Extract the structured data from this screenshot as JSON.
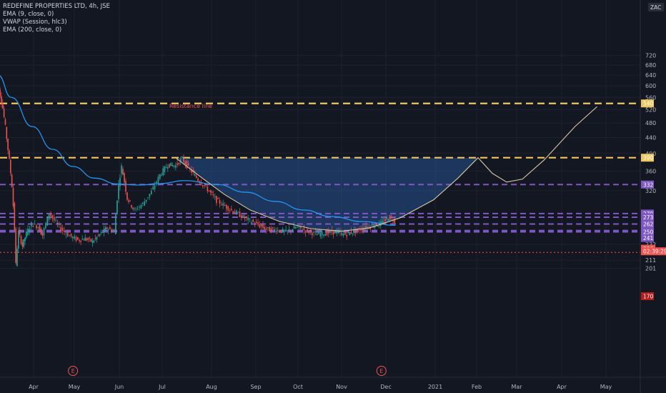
{
  "header": {
    "symbol": "REDEFINE PROPERTIES LTD, 4h, JSE",
    "indicators": [
      "EMA (9, close, 0)",
      "VWAP (Session, hlc3)",
      "EMA (200, close, 0)"
    ],
    "currency": "ZAC"
  },
  "colors": {
    "background": "#131722",
    "grid": "#1e222d",
    "up": "#26a69a",
    "down": "#ef5350",
    "ema200": "#2196f3",
    "resistance": "#f0c75e",
    "support": "#7e57c2",
    "cup_fill": "#2a5ea8",
    "cup_line": "#d9c7a3",
    "current_price": "#ef5350",
    "annotation_text": "#ef5350"
  },
  "chart_data": {
    "type": "candlestick",
    "timeframe": "4h",
    "ylim": [
      166,
      740
    ],
    "y_ticks": [
      720,
      680,
      640,
      600,
      560,
      520,
      480,
      440,
      400,
      360,
      320,
      232,
      211,
      201
    ],
    "x_ticks": [
      "Apr",
      "May",
      "Jun",
      "Jul",
      "Aug",
      "Sep",
      "Oct",
      "Nov",
      "Dec",
      "2021",
      "Feb",
      "Mar",
      "Apr",
      "May"
    ],
    "price_series": {
      "name": "close",
      "points": [
        [
          "Mar 02",
          582
        ],
        [
          "Mar 05",
          596
        ],
        [
          "Mar 07",
          570
        ],
        [
          "Mar 09",
          525
        ],
        [
          "Mar 11",
          468
        ],
        [
          "Mar 13",
          410
        ],
        [
          "Mar 16",
          330
        ],
        [
          "Mar 18",
          255
        ],
        [
          "Mar 19",
          205
        ],
        [
          "Mar 21",
          250
        ],
        [
          "Mar 24",
          230
        ],
        [
          "Mar 27",
          248
        ],
        [
          "Mar 31",
          262
        ],
        [
          "Apr 05",
          258
        ],
        [
          "Apr 08",
          245
        ],
        [
          "Apr 13",
          280
        ],
        [
          "Apr 18",
          264
        ],
        [
          "Apr 23",
          252
        ],
        [
          "Apr 28",
          244
        ],
        [
          "May 04",
          238
        ],
        [
          "May 09",
          240
        ],
        [
          "May 14",
          236
        ],
        [
          "May 19",
          246
        ],
        [
          "May 24",
          256
        ],
        [
          "May 29",
          250
        ],
        [
          "Jun 01",
          332
        ],
        [
          "Jun 03",
          370
        ],
        [
          "Jun 07",
          306
        ],
        [
          "Jun 12",
          284
        ],
        [
          "Jun 18",
          296
        ],
        [
          "Jun 24",
          318
        ],
        [
          "Jun 30",
          352
        ],
        [
          "Jul 05",
          374
        ],
        [
          "Jul 10",
          372
        ],
        [
          "Jul 14",
          388
        ],
        [
          "Jul 18",
          367
        ],
        [
          "Jul 24",
          342
        ],
        [
          "Jul 29",
          326
        ],
        [
          "Aug 05",
          302
        ],
        [
          "Aug 12",
          290
        ],
        [
          "Aug 19",
          280
        ],
        [
          "Aug 26",
          270
        ],
        [
          "Sep 02",
          262
        ],
        [
          "Sep 09",
          254
        ],
        [
          "Sep 16",
          253
        ],
        [
          "Sep 23",
          250
        ],
        [
          "Sep 30",
          257
        ],
        [
          "Oct 07",
          252
        ],
        [
          "Oct 14",
          247
        ],
        [
          "Oct 21",
          248
        ],
        [
          "Oct 28",
          250
        ],
        [
          "Nov 04",
          246
        ],
        [
          "Nov 09",
          250
        ],
        [
          "Nov 16",
          255
        ],
        [
          "Nov 23",
          260
        ],
        [
          "Nov 28",
          262
        ],
        [
          "Dec 03",
          273
        ],
        [
          "Dec 07",
          268
        ]
      ]
    },
    "ema200": {
      "name": "EMA (200, close, 0)",
      "points": [
        [
          "Feb 24",
          708
        ],
        [
          "Mar 05",
          640
        ],
        [
          "Mar 15",
          560
        ],
        [
          "Mar 31",
          470
        ],
        [
          "Apr 15",
          410
        ],
        [
          "Apr 30",
          370
        ],
        [
          "May 15",
          345
        ],
        [
          "May 31",
          333
        ],
        [
          "Jun 15",
          331
        ],
        [
          "Jun 30",
          334
        ],
        [
          "Jul 15",
          340
        ],
        [
          "Aug 05",
          332
        ],
        [
          "Aug 25",
          317
        ],
        [
          "Sep 15",
          300
        ],
        [
          "Oct 05",
          285
        ],
        [
          "Oct 25",
          274
        ],
        [
          "Nov 15",
          266
        ],
        [
          "Dec 07",
          260
        ]
      ]
    },
    "horizontal_levels": [
      {
        "kind": "resistance",
        "value": 540,
        "label": "540"
      },
      {
        "kind": "resistance",
        "value": 390,
        "label": "390"
      },
      {
        "kind": "support",
        "value": 332,
        "label": "332"
      },
      {
        "kind": "support",
        "value": 279,
        "label": "279"
      },
      {
        "kind": "support",
        "value": 273,
        "label": "273"
      },
      {
        "kind": "support",
        "value": 262,
        "label": "262"
      },
      {
        "kind": "support",
        "value": 252,
        "label": "252"
      },
      {
        "kind": "support",
        "value": 250,
        "label": "250"
      }
    ],
    "current_price": {
      "value": 226,
      "time_label": "02:39:29"
    },
    "last_value": {
      "value": 241
    },
    "lows_line": {
      "value": 221
    },
    "last_low": {
      "value": 170
    },
    "cup_and_handle": {
      "points": [
        [
          "Jul 10",
          388
        ],
        [
          "Jul 25",
          348
        ],
        [
          "Aug 10",
          313
        ],
        [
          "Aug 28",
          285
        ],
        [
          "Sep 18",
          266
        ],
        [
          "Oct 10",
          255
        ],
        [
          "Nov 01",
          251
        ],
        [
          "Nov 20",
          256
        ],
        [
          "Dec 10",
          272
        ],
        [
          "Dec 31",
          303
        ],
        [
          "Jan 18",
          345
        ],
        [
          "Feb 02",
          390
        ],
        [
          "Feb 12",
          355
        ],
        [
          "Feb 22",
          337
        ],
        [
          "Mar 05",
          343
        ],
        [
          "Mar 20",
          385
        ],
        [
          "Apr 10",
          470
        ],
        [
          "Apr 25",
          530
        ]
      ]
    },
    "annotations": [
      {
        "text": "Resistance line",
        "x": "May 20",
        "y": 533
      }
    ],
    "event_markers": [
      {
        "label": "E",
        "x": "Apr 30"
      },
      {
        "label": "E",
        "x": "Nov 28"
      }
    ]
  }
}
